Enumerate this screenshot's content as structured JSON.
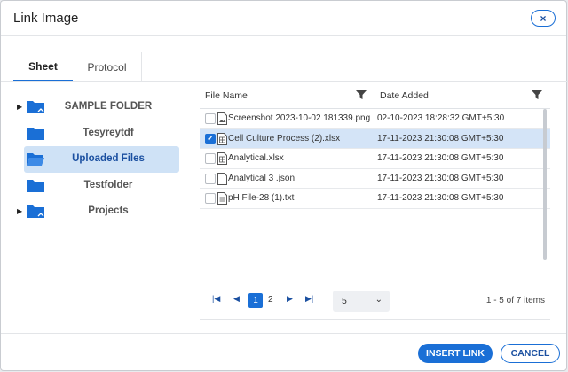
{
  "dialog": {
    "title": "Link Image",
    "close_label": "×"
  },
  "tabs": [
    {
      "label": "Sheet"
    },
    {
      "label": "Protocol"
    }
  ],
  "folders": [
    {
      "label": "SAMPLE FOLDER",
      "expandable": true,
      "icon": "folder-shared-icon"
    },
    {
      "label": "Tesyreytdf",
      "expandable": false,
      "icon": "folder-icon"
    },
    {
      "label": "Uploaded Files",
      "expandable": false,
      "icon": "folder-open-icon",
      "selected": true
    },
    {
      "label": "Testfolder",
      "expandable": false,
      "icon": "folder-icon"
    },
    {
      "label": "Projects",
      "expandable": true,
      "icon": "folder-shared-icon"
    }
  ],
  "table": {
    "headers": {
      "file_name": "File Name",
      "date_added": "Date Added"
    },
    "rows": [
      {
        "name": "Screenshot 2023-10-02 181339.png",
        "date": "02-10-2023 18:28:32 GMT+5:30",
        "icon": "image-file-icon",
        "checked": false
      },
      {
        "name": "Cell Culture Process (2).xlsx",
        "date": "17-11-2023 21:30:08 GMT+5:30",
        "icon": "spreadsheet-file-icon",
        "checked": true
      },
      {
        "name": "Analytical.xlsx",
        "date": "17-11-2023 21:30:08 GMT+5:30",
        "icon": "spreadsheet-file-icon",
        "checked": false
      },
      {
        "name": "Analytical 3 .json",
        "date": "17-11-2023 21:30:08 GMT+5:30",
        "icon": "generic-file-icon",
        "checked": false
      },
      {
        "name": "pH File-28 (1).txt",
        "date": "17-11-2023 21:30:08 GMT+5:30",
        "icon": "text-file-icon",
        "checked": false
      }
    ]
  },
  "pagination": {
    "first_icon": "first-page-icon",
    "prev_icon": "prev-page-icon",
    "next_icon": "next-page-icon",
    "last_icon": "last-page-icon",
    "pages": [
      "1",
      "2"
    ],
    "current_page": "1",
    "page_size": "5",
    "summary": "1 - 5 of 7 items"
  },
  "footer": {
    "insert_label": "INSERT LINK",
    "cancel_label": "CANCEL"
  },
  "colors": {
    "accent": "#1a6fd6",
    "selected_row": "#d4e4f7",
    "selected_folder": "#cfe2f6"
  }
}
